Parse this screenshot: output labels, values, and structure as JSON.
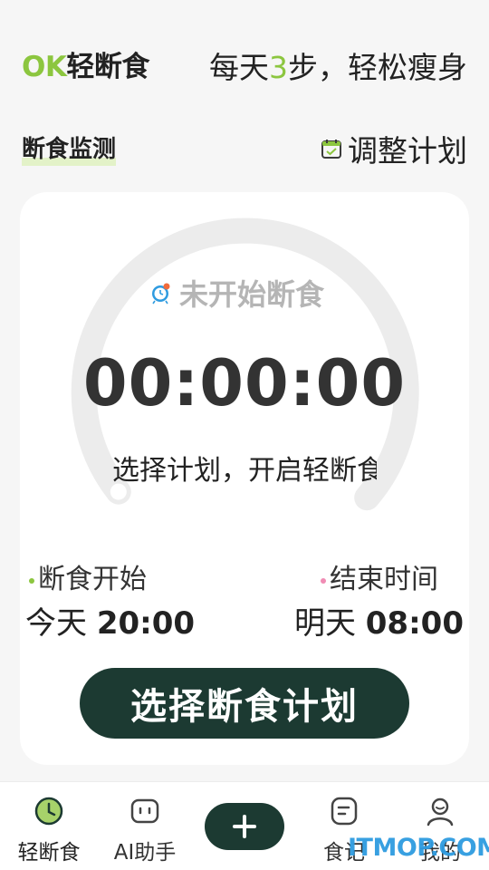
{
  "header": {
    "brand_ok": "OK",
    "brand_rest": "轻断食",
    "slogan_pre": "每天",
    "slogan_num": "3",
    "slogan_post": "步，轻松瘦身"
  },
  "section": {
    "title": "断食监测",
    "adjust_label": "调整计划"
  },
  "timer": {
    "status": "未开始断食",
    "value": "00:00:00",
    "hint": "选择计划，开启轻断食",
    "progress": 0
  },
  "schedule": {
    "start_label": "断食开始",
    "start_day": "今天",
    "start_time": "20:00",
    "end_label": "结束时间",
    "end_day": "明天",
    "end_time": "08:00"
  },
  "cta": {
    "label": "选择断食计划"
  },
  "tabs": [
    {
      "label": "轻断食",
      "icon": "clock-icon",
      "active": true
    },
    {
      "label": "AI助手",
      "icon": "robot-icon",
      "active": false
    },
    {
      "label": "食记",
      "icon": "note-icon",
      "active": false
    },
    {
      "label": "我的",
      "icon": "profile-icon",
      "active": false
    }
  ],
  "watermark": "ITMOP.COM",
  "colors": {
    "accent": "#8cc63f",
    "dark": "#1c3a32",
    "ring": "#ececec",
    "end_dot": "#f08cb4"
  }
}
